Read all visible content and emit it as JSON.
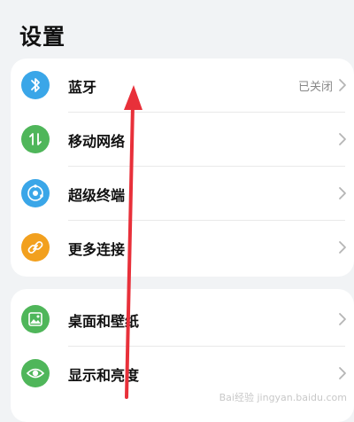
{
  "page": {
    "title": "设置"
  },
  "card1": {
    "items": [
      {
        "label": "蓝牙",
        "value": "已关闭",
        "icon": "bluetooth-icon",
        "color": "#3aa6e8"
      },
      {
        "label": "移动网络",
        "icon": "mobile-data-icon",
        "color": "#4fb65a"
      },
      {
        "label": "超级终端",
        "icon": "super-device-icon",
        "color": "#3aa6e8"
      },
      {
        "label": "更多连接",
        "icon": "link-icon",
        "color": "#f2a01e"
      }
    ]
  },
  "card2": {
    "items": [
      {
        "label": "桌面和壁纸",
        "icon": "wallpaper-icon",
        "color": "#4fb65a"
      },
      {
        "label": "显示和亮度",
        "icon": "eye-icon",
        "color": "#4fb65a"
      }
    ]
  },
  "watermark": "Bai经验 jingyan.baidu.com",
  "annotation_arrow_color": "#e8303a"
}
